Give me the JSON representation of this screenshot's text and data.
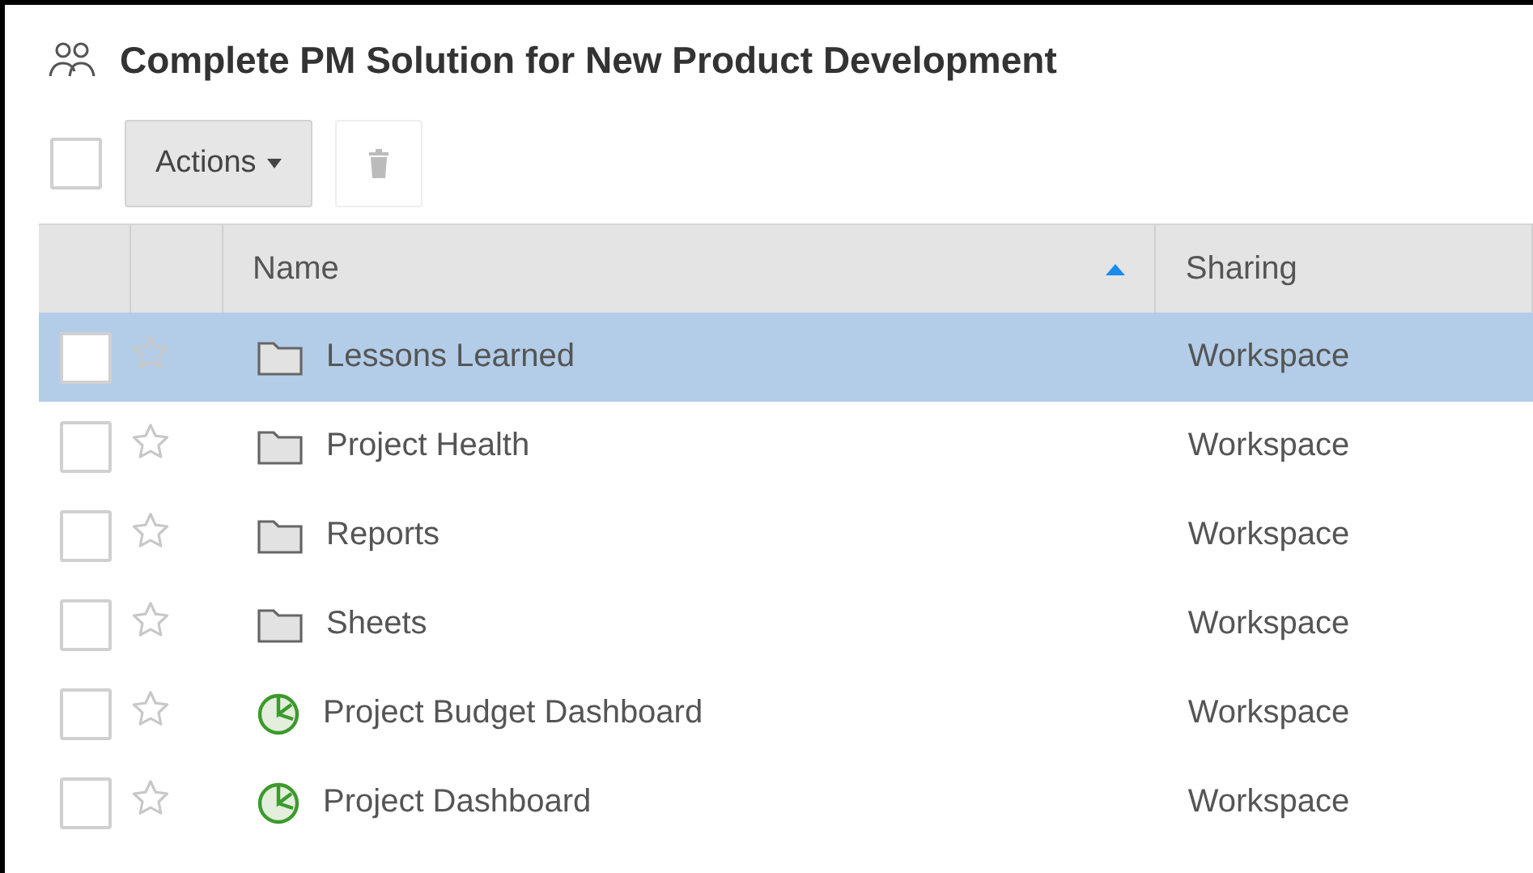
{
  "header": {
    "title": "Complete PM Solution for New Product Development"
  },
  "toolbar": {
    "select_all": {
      "checked": false
    },
    "actions_label": "Actions",
    "delete_disabled": true
  },
  "table": {
    "columns": [
      {
        "label": "Name",
        "sorted_ascending": true
      },
      {
        "label": "Sharing"
      }
    ],
    "rows": [
      {
        "kind": "folder",
        "name": "Lessons Learned",
        "sharing": "Workspace",
        "selected": true,
        "checked": false,
        "starred": false
      },
      {
        "kind": "folder",
        "name": "Project Health",
        "sharing": "Workspace",
        "selected": false,
        "checked": false,
        "starred": false
      },
      {
        "kind": "folder",
        "name": "Reports",
        "sharing": "Workspace",
        "selected": false,
        "checked": false,
        "starred": false
      },
      {
        "kind": "folder",
        "name": "Sheets",
        "sharing": "Workspace",
        "selected": false,
        "checked": false,
        "starred": false
      },
      {
        "kind": "dashboard",
        "name": "Project Budget Dashboard",
        "sharing": "Workspace",
        "selected": false,
        "checked": false,
        "starred": false
      },
      {
        "kind": "dashboard",
        "name": "Project Dashboard",
        "sharing": "Workspace",
        "selected": false,
        "checked": false,
        "starred": false
      }
    ]
  }
}
